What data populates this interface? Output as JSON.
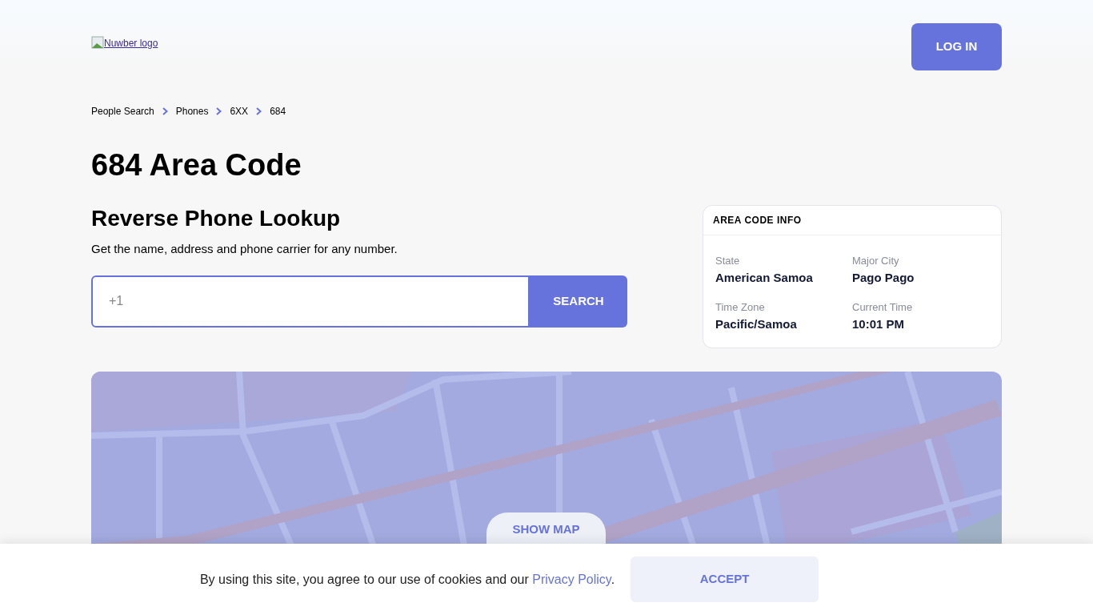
{
  "header": {
    "logo_alt": "Nuwber logo",
    "login_button": "LOG IN"
  },
  "breadcrumbs": [
    "People Search",
    "Phones",
    "6XX",
    "684"
  ],
  "title": "684 Area Code",
  "lookup": {
    "heading": "Reverse Phone Lookup",
    "subtitle": "Get the name, address and phone carrier for any number.",
    "placeholder": "+1",
    "button": "SEARCH"
  },
  "info_card": {
    "title": "AREA CODE INFO",
    "fields": [
      {
        "label": "State",
        "value": "American Samoa"
      },
      {
        "label": "Major City",
        "value": "Pago Pago"
      },
      {
        "label": "Time Zone",
        "value": "Pacific/Samoa"
      },
      {
        "label": "Current Time",
        "value": "10:01 PM"
      }
    ]
  },
  "map": {
    "button": "SHOW MAP"
  },
  "cookie_banner": {
    "text_before": "By using this site, you agree to our use of cookies and our ",
    "link": "Privacy Policy",
    "text_after": ".",
    "button": "ACCEPT"
  }
}
